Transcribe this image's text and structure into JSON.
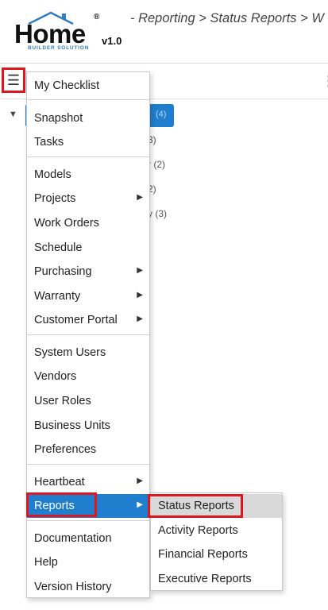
{
  "header": {
    "logo_text": "Home",
    "logo_reg": "®",
    "logo_subtitle": "BUILDER SOLUTION",
    "logo_version": "v1.0",
    "breadcrumb": "- Reporting > Status Reports > W"
  },
  "toolbar": {
    "menu_icon": "hamburger-icon",
    "more_icon": "kebab-icon"
  },
  "tree": {
    "count_main": "(4)",
    "rows": [
      "3)",
      "r (2)",
      "2)",
      "y (3)"
    ]
  },
  "menu": {
    "groups": [
      [
        {
          "label": "My Checklist"
        }
      ],
      [
        {
          "label": "Snapshot"
        },
        {
          "label": "Tasks"
        }
      ],
      [
        {
          "label": "Models"
        },
        {
          "label": "Projects",
          "submenu": true
        },
        {
          "label": "Work Orders"
        },
        {
          "label": "Schedule"
        },
        {
          "label": "Purchasing",
          "submenu": true
        },
        {
          "label": "Warranty",
          "submenu": true
        },
        {
          "label": "Customer Portal",
          "submenu": true
        }
      ],
      [
        {
          "label": "System Users"
        },
        {
          "label": "Vendors"
        },
        {
          "label": "User Roles"
        },
        {
          "label": "Business Units"
        },
        {
          "label": "Preferences"
        }
      ],
      [
        {
          "label": "Heartbeat",
          "submenu": true
        },
        {
          "label": "Reports",
          "submenu": true,
          "active": true
        }
      ],
      [
        {
          "label": "Documentation"
        },
        {
          "label": "Help"
        },
        {
          "label": "Version History"
        }
      ]
    ]
  },
  "submenu": {
    "items": [
      {
        "label": "Status Reports",
        "hover": true
      },
      {
        "label": "Activity Reports"
      },
      {
        "label": "Financial Reports"
      },
      {
        "label": "Executive Reports"
      }
    ]
  },
  "colors": {
    "accent": "#1f7fce",
    "highlight_outline": "#e0161e",
    "hover_bg": "#d9d9d9",
    "logo_blue": "#2f7ebf"
  }
}
